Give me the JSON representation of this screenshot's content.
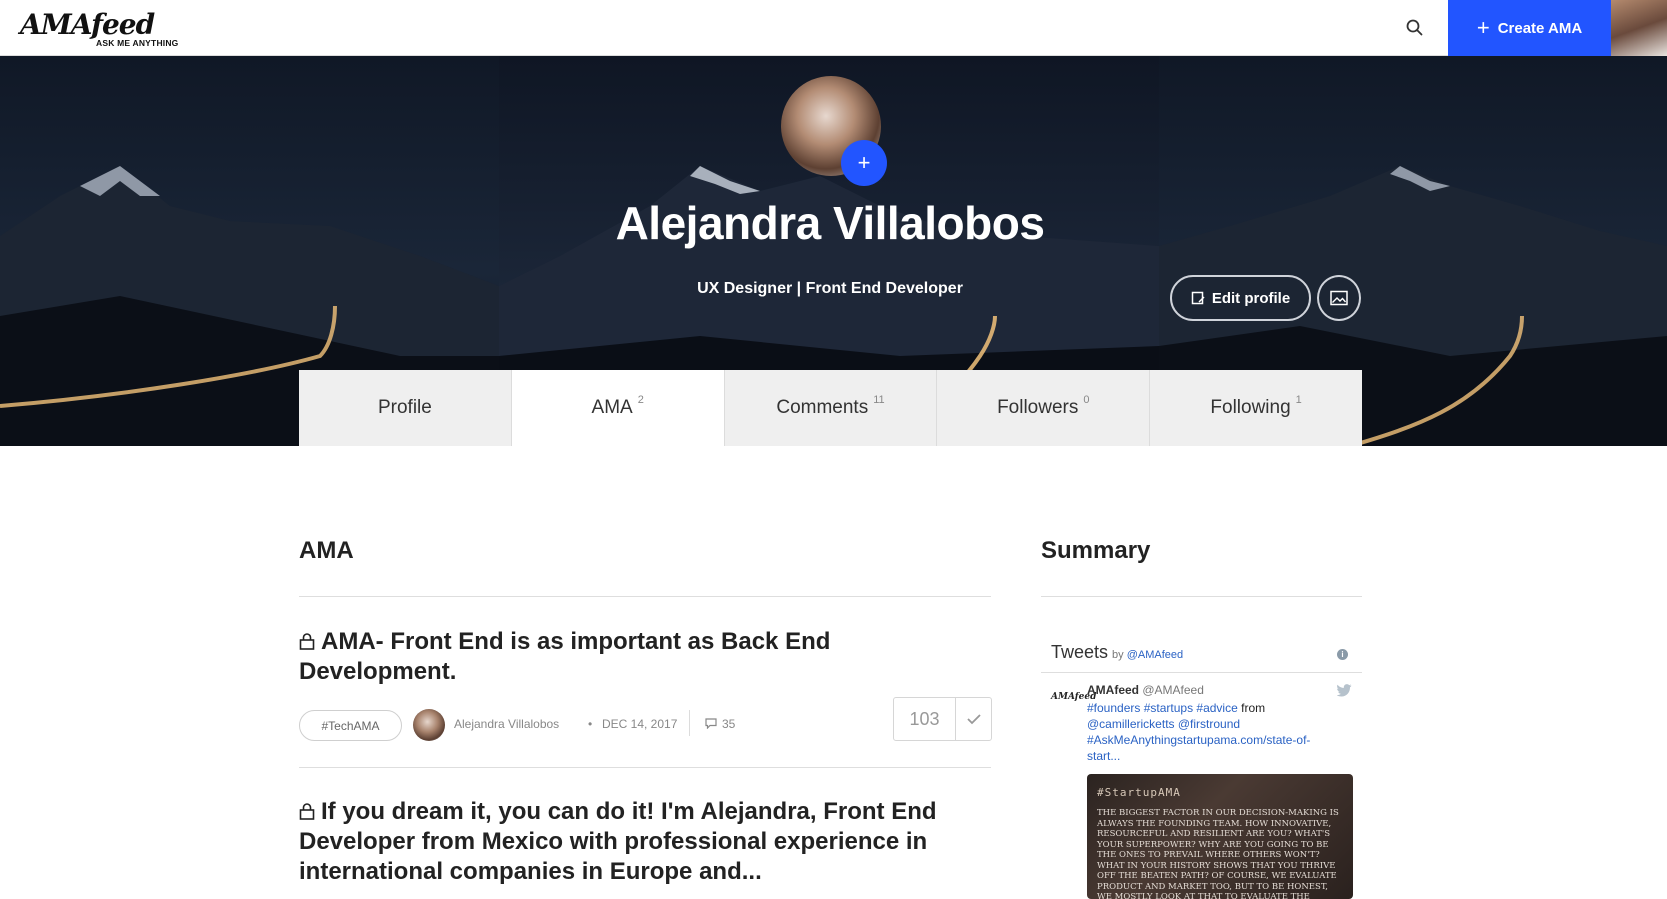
{
  "brand": {
    "logo": "AMAfeed",
    "tagline": "ASK ME ANYTHING"
  },
  "topbar": {
    "create_label": "Create AMA"
  },
  "profile": {
    "name": "Alejandra Villalobos",
    "title": "UX Designer | Front End Developer",
    "edit_label": "Edit profile"
  },
  "tabs": [
    {
      "label": "Profile",
      "count": ""
    },
    {
      "label": "AMA",
      "count": "2"
    },
    {
      "label": "Comments",
      "count": "11"
    },
    {
      "label": "Followers",
      "count": "0"
    },
    {
      "label": "Following",
      "count": "1"
    }
  ],
  "ama_section": {
    "heading": "AMA",
    "items": [
      {
        "title": "AMA- Front End is as important as Back End Development.",
        "tag": "#TechAMA",
        "author": "Alejandra Villalobos",
        "date": "DEC 14, 2017",
        "comments": "35",
        "votes": "103"
      },
      {
        "title": "If you dream it, you can do it! I'm Alejandra, Front End Developer from Mexico with professional experience in international companies in Europe and..."
      }
    ]
  },
  "summary": {
    "heading": "Summary",
    "tweets": {
      "label": "Tweets",
      "by": "by",
      "handle": "@AMAfeed",
      "tweet": {
        "logo_text": "AMAfeed",
        "author": "AMAfeed",
        "handle": "@AMAfeed",
        "tags": "#founders #startups #advice",
        "from": "from",
        "mentions": "@camillericketts @firstround",
        "link": "#AskMeAnythingstartupama.com/state-of-start...",
        "media_tag": "#StartupAMA",
        "media_text": "THE BIGGEST FACTOR IN OUR DECISION-MAKING IS ALWAYS THE FOUNDING TEAM. HOW INNOVATIVE, RESOURCEFUL AND RESILIENT ARE YOU? WHAT'S YOUR SUPERPOWER? WHY ARE YOU GOING TO BE THE ONES TO PREVAIL WHERE OTHERS WON'T? WHAT IN YOUR HISTORY SHOWS THAT YOU THRIVE OFF THE BEATEN PATH? OF COURSE, WE EVALUATE PRODUCT AND MARKET TOO, BUT TO BE HONEST, WE MOSTLY LOOK AT THAT TO EVALUATE THE"
      }
    }
  },
  "colors": {
    "accent": "#2255ff",
    "hero_dark": "#101826"
  },
  "icons": [
    "search-icon",
    "plus-icon",
    "edit-icon",
    "image-icon",
    "lock-icon",
    "comment-icon",
    "check-icon",
    "info-icon",
    "twitter-bird-icon"
  ]
}
